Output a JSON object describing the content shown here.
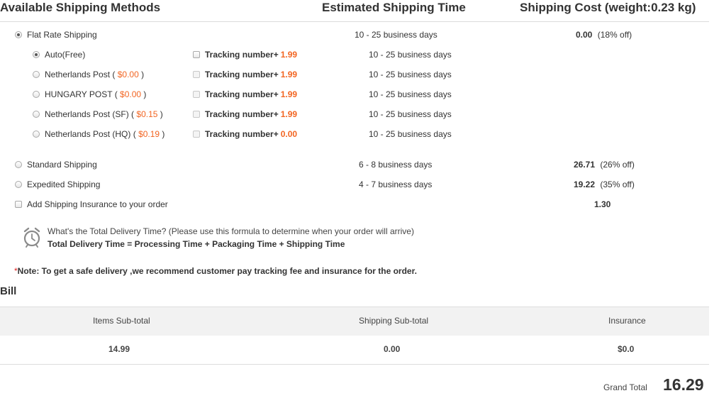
{
  "header": {
    "methods": "Available Shipping Methods",
    "time": "Estimated Shipping Time",
    "cost": "Shipping Cost (weight:0.23 kg)"
  },
  "flat_rate": {
    "label": "Flat Rate Shipping",
    "days": "10 - 25 business days",
    "price": "0.00",
    "discount": "(18% off)",
    "options": [
      {
        "name": "Auto(Free)",
        "price": "",
        "tracking_label": "Tracking number+",
        "tracking_price": "1.99",
        "days": "10 - 25 business days"
      },
      {
        "name": "Netherlands Post",
        "price": "$0.00",
        "tracking_label": "Tracking number+",
        "tracking_price": "1.99",
        "days": "10 - 25 business days"
      },
      {
        "name": "HUNGARY POST",
        "price": "$0.00",
        "tracking_label": "Tracking number+",
        "tracking_price": "1.99",
        "days": "10 - 25 business days"
      },
      {
        "name": "Netherlands Post (SF)",
        "price": "$0.15",
        "tracking_label": "Tracking number+",
        "tracking_price": "1.99",
        "days": "10 - 25 business days"
      },
      {
        "name": "Netherlands Post (HQ)",
        "price": "$0.19",
        "tracking_label": "Tracking number+",
        "tracking_price": "0.00",
        "days": "10 - 25 business days"
      }
    ]
  },
  "standard": {
    "label": "Standard Shipping",
    "days": "6 - 8 business days",
    "price": "26.71",
    "discount": "(26% off)"
  },
  "expedited": {
    "label": "Expedited Shipping",
    "days": "4 - 7 business days",
    "price": "19.22",
    "discount": "(35% off)"
  },
  "insurance": {
    "label": "Add Shipping Insurance to your order",
    "price": "1.30"
  },
  "delivery": {
    "question": "What's the Total Delivery Time? (Please use this formula to determine when your order will arrive)",
    "formula": "Total Delivery Time = Processing Time + Packaging Time + Shipping Time"
  },
  "note": {
    "star": "*",
    "text": "Note: To get a safe delivery ,we recommend customer pay tracking fee and insurance for the order."
  },
  "bill": {
    "title": "Bill",
    "col_items": "Items Sub-total",
    "col_shipping": "Shipping Sub-total",
    "col_insurance": "Insurance",
    "items": "14.99",
    "shipping": "0.00",
    "insurance": "$0.0",
    "grand_total_label": "Grand Total",
    "grand_total": "16.29"
  }
}
